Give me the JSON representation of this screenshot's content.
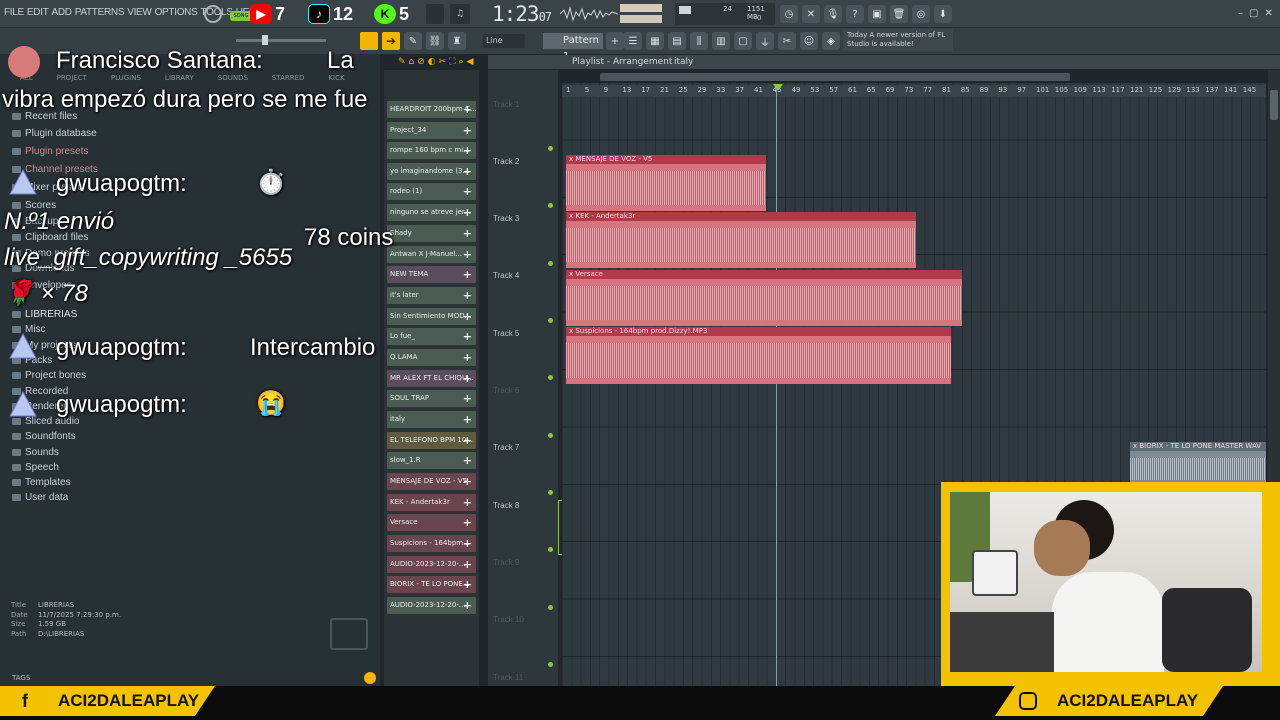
{
  "menu": [
    "FILE",
    "EDIT",
    "ADD",
    "PATTERNS",
    "VIEW",
    "OPTIONS",
    "TOOLS",
    "HELP"
  ],
  "socials_top": {
    "youtube": "7",
    "tiktok": "12",
    "kick": "5"
  },
  "transport": {
    "time": "1:23",
    "time_sub": "07",
    "song_label": "SONG"
  },
  "memory": {
    "cpu": "24",
    "mem": "1151 MB",
    "voices": "0"
  },
  "toolbar2": {
    "snap": "Line",
    "pattern": "Pattern 1",
    "news": "Today  A newer version of FL Studio is available!"
  },
  "browser": {
    "tabs": [
      "ALL",
      "PROJECT",
      "PLUGINS",
      "LIBRARY",
      "SOUNDS",
      "STARRED",
      "KICK"
    ],
    "items": [
      {
        "label": "Recent files",
        "icon": "folder-icon"
      },
      {
        "label": "Plugin database",
        "icon": "folder-icon"
      },
      {
        "label": "Plugin presets",
        "icon": "folder-icon"
      },
      {
        "label": "Channel presets",
        "icon": "folder-icon"
      },
      {
        "label": "Mixer presets",
        "icon": "folder-icon"
      },
      {
        "label": "Scores",
        "icon": "folder-icon"
      },
      {
        "label": "Backup",
        "icon": "folder-icon"
      },
      {
        "label": "Clipboard files",
        "icon": "folder-icon"
      },
      {
        "label": "Demo projects",
        "icon": "folder-icon"
      },
      {
        "label": "Downloads",
        "icon": "folder-icon"
      },
      {
        "label": "Envelopes",
        "icon": "folder-icon"
      },
      {
        "label": "LIBRERIAS",
        "icon": "folder-icon"
      },
      {
        "label": "Misc",
        "icon": "folder-icon"
      },
      {
        "label": "My projects",
        "icon": "folder-icon"
      },
      {
        "label": "Packs",
        "icon": "folder-icon"
      },
      {
        "label": "Project bones",
        "icon": "folder-icon"
      },
      {
        "label": "Recorded",
        "icon": "folder-icon"
      },
      {
        "label": "Rendered",
        "icon": "folder-icon"
      },
      {
        "label": "Sliced audio",
        "icon": "folder-icon"
      },
      {
        "label": "Soundfonts",
        "icon": "folder-icon"
      },
      {
        "label": "Sounds",
        "icon": "folder-icon"
      },
      {
        "label": "Speech",
        "icon": "folder-icon"
      },
      {
        "label": "Templates",
        "icon": "folder-icon"
      },
      {
        "label": "User data",
        "icon": "user-icon"
      }
    ],
    "info": {
      "title_k": "Title",
      "title": "LIBRERIAS",
      "date_k": "Date",
      "date": "11/7/2025 7:29:30 p.m.",
      "size_k": "Size",
      "size": "1.59 GB",
      "path_k": "Path",
      "path": "D:\\LIBRERIAS"
    },
    "tags": "TAGS"
  },
  "channels": [
    "HEARDROIT 200bpm C...",
    "Project_34",
    "rompe 160 bpm c mi...",
    "yo imaginandome (3...",
    "rodeo (1)",
    "ninguno se atreve jer...",
    "Shady",
    "Antwan X J-Manuel...",
    "NEW TEMA",
    "it's later",
    "Sin Sentimiento MOD...",
    "Lo fue_",
    "Q.LAMA",
    "MR ALEX FT EL CHIQU...",
    "SOUL TRAP",
    "italy",
    "EL TELEFONO BPM 10...",
    "slow_1.R",
    "MENSAJE DE VOZ - V5",
    "KEK - Andertak3r",
    "Versace",
    "Suspicions - 164bpm...",
    "BIORIX - TE LO PONE...",
    "AUDIO-2023-12-20-...",
    "AUDIO-2023-12-20-..."
  ],
  "playlist": {
    "title": "Playlist - Arrangement",
    "crumb": "italy",
    "ruler": [
      "1",
      "5",
      "9",
      "13",
      "17",
      "21",
      "25",
      "29",
      "33",
      "37",
      "41",
      "45",
      "49",
      "53",
      "57",
      "61",
      "65",
      "69",
      "73",
      "77",
      "81",
      "85",
      "89",
      "93",
      "97",
      "101",
      "105",
      "109",
      "113",
      "117",
      "121",
      "125",
      "129",
      "133",
      "137",
      "141",
      "145"
    ],
    "tracks": [
      {
        "label": "Track 1",
        "dim": true
      },
      {
        "label": "Track 2",
        "dim": false
      },
      {
        "label": "Track 3",
        "dim": false
      },
      {
        "label": "Track 4",
        "dim": false
      },
      {
        "label": "Track 5",
        "dim": false
      },
      {
        "label": "Track 6",
        "dim": true
      },
      {
        "label": "Track 7",
        "dim": false
      },
      {
        "label": "Track 8",
        "dim": false
      },
      {
        "label": "Track 9",
        "dim": true
      },
      {
        "label": "Track 10",
        "dim": true
      },
      {
        "label": "Track 11",
        "dim": true
      }
    ],
    "clips": [
      {
        "label": "x MENSAJE DE VOZ - V5"
      },
      {
        "label": "x KEK - Andertak3r"
      },
      {
        "label": "x Versace"
      },
      {
        "label": "x Suspicions - 164bpm prod.Dizzy!.MP3"
      },
      {
        "label": "x BIORIX - TE LO PONE MASTER WAV"
      }
    ]
  },
  "chat": [
    {
      "user": "Francisco Santana:",
      "text": "La vibra empezó dura pero se me fue"
    },
    {
      "user": "gwuapogtm:",
      "text": "⏱️"
    },
    {
      "user": "",
      "text": "N.º1 envió live_gift_copywriting _5655 🌹 × 78"
    },
    {
      "user": "gwuapogtm:",
      "text": "Intercambio"
    },
    {
      "user": "gwuapogtm:",
      "text": "😭"
    }
  ],
  "coins": "78 coins",
  "footer": {
    "facebook": "ACI2DALEAPLAY",
    "instagram": "ACI2DALEAPLAY"
  }
}
